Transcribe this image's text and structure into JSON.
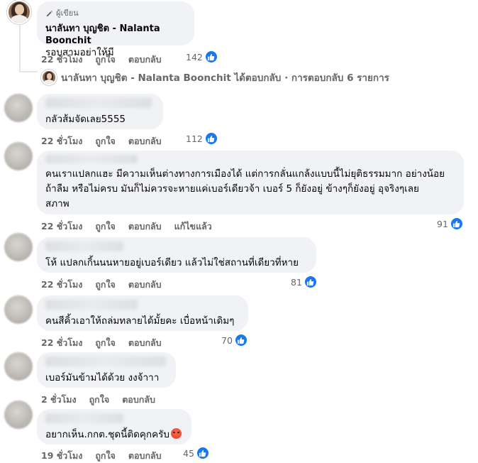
{
  "comment1": {
    "badge_label": "ผู้เขียน",
    "author": "นาลันทา บุญชิต - Nalanta Boonchit",
    "text": "รอบสามอย่าให้มี",
    "time": "22 ชั่วโมง",
    "like_label": "ถูกใจ",
    "reply_label": "ตอบกลับ",
    "reaction_count": "142"
  },
  "reply_summary": {
    "text": "นาลันทา บุญชิต - Nalanta Boonchit ได้ตอบกลับ · การตอบกลับ 6 รายการ"
  },
  "comments": [
    {
      "text": "กลัวส้มจัดเลย5555",
      "time": "22 ชั่วโมง",
      "like_label": "ถูกใจ",
      "reply_label": "ตอบกลับ",
      "edited_label": "",
      "reaction_count": "112"
    },
    {
      "text": "คนเราแปลกแฮะ มีความเห็นต่างทางการเมืองได้ แต่การกลั่นแกล้งแบบนี้ไม่ยุติธรรมมาก อย่างน้อย\nถ้าลืม หรือไม่ครบ มันก็ไม่ควรจะหายแค่เบอร์เดียวจ้า เบอร์ 5 ก็ยังอยู่ ข้างๆก็ยังอยู่ อุจริงๆเลย\nสภาพ",
      "time": "22 ชั่วโมง",
      "like_label": "ถูกใจ",
      "reply_label": "ตอบกลับ",
      "edited_label": "แก้ไขแล้ว",
      "reaction_count": "91"
    },
    {
      "text": "โห้ แปลกเกิ้นนนหายอยู่เบอร์เดียว แล้วไม่ใช่สถานที่เดียวที่หาย",
      "time": "22 ชั่วโมง",
      "like_label": "ถูกใจ",
      "reply_label": "ตอบกลับ",
      "edited_label": "",
      "reaction_count": "81"
    },
    {
      "text": "คนสีคิ้วเอาให้ถล่มทลายได้มั้ยคะ เบื่อหน้าเดิมๆ",
      "time": "22 ชั่วโมง",
      "like_label": "ถูกใจ",
      "reply_label": "ตอบกลับ",
      "edited_label": "",
      "reaction_count": "70"
    },
    {
      "text": "เบอร์มันข้ามได้ด้วย งงจ้าาา",
      "time": "2 ชั่วโมง",
      "like_label": "ถูกใจ",
      "reply_label": "ตอบกลับ",
      "edited_label": "",
      "reaction_count": ""
    },
    {
      "text": "อยากเห็น.กกต.ชุดนี้ติดคุกครับ",
      "time": "19 ชั่วโมง",
      "like_label": "ถูกใจ",
      "reply_label": "ตอบกลับ",
      "edited_label": "",
      "reaction_count": "45"
    }
  ],
  "icons": {
    "like": "thumbs-up-icon",
    "author_badge": "pencil-icon",
    "emoji": "angry-face-icon"
  },
  "colors": {
    "like_blue": "#1877f2",
    "bubble": "#f0f2f5",
    "meta_text": "#65676b"
  }
}
